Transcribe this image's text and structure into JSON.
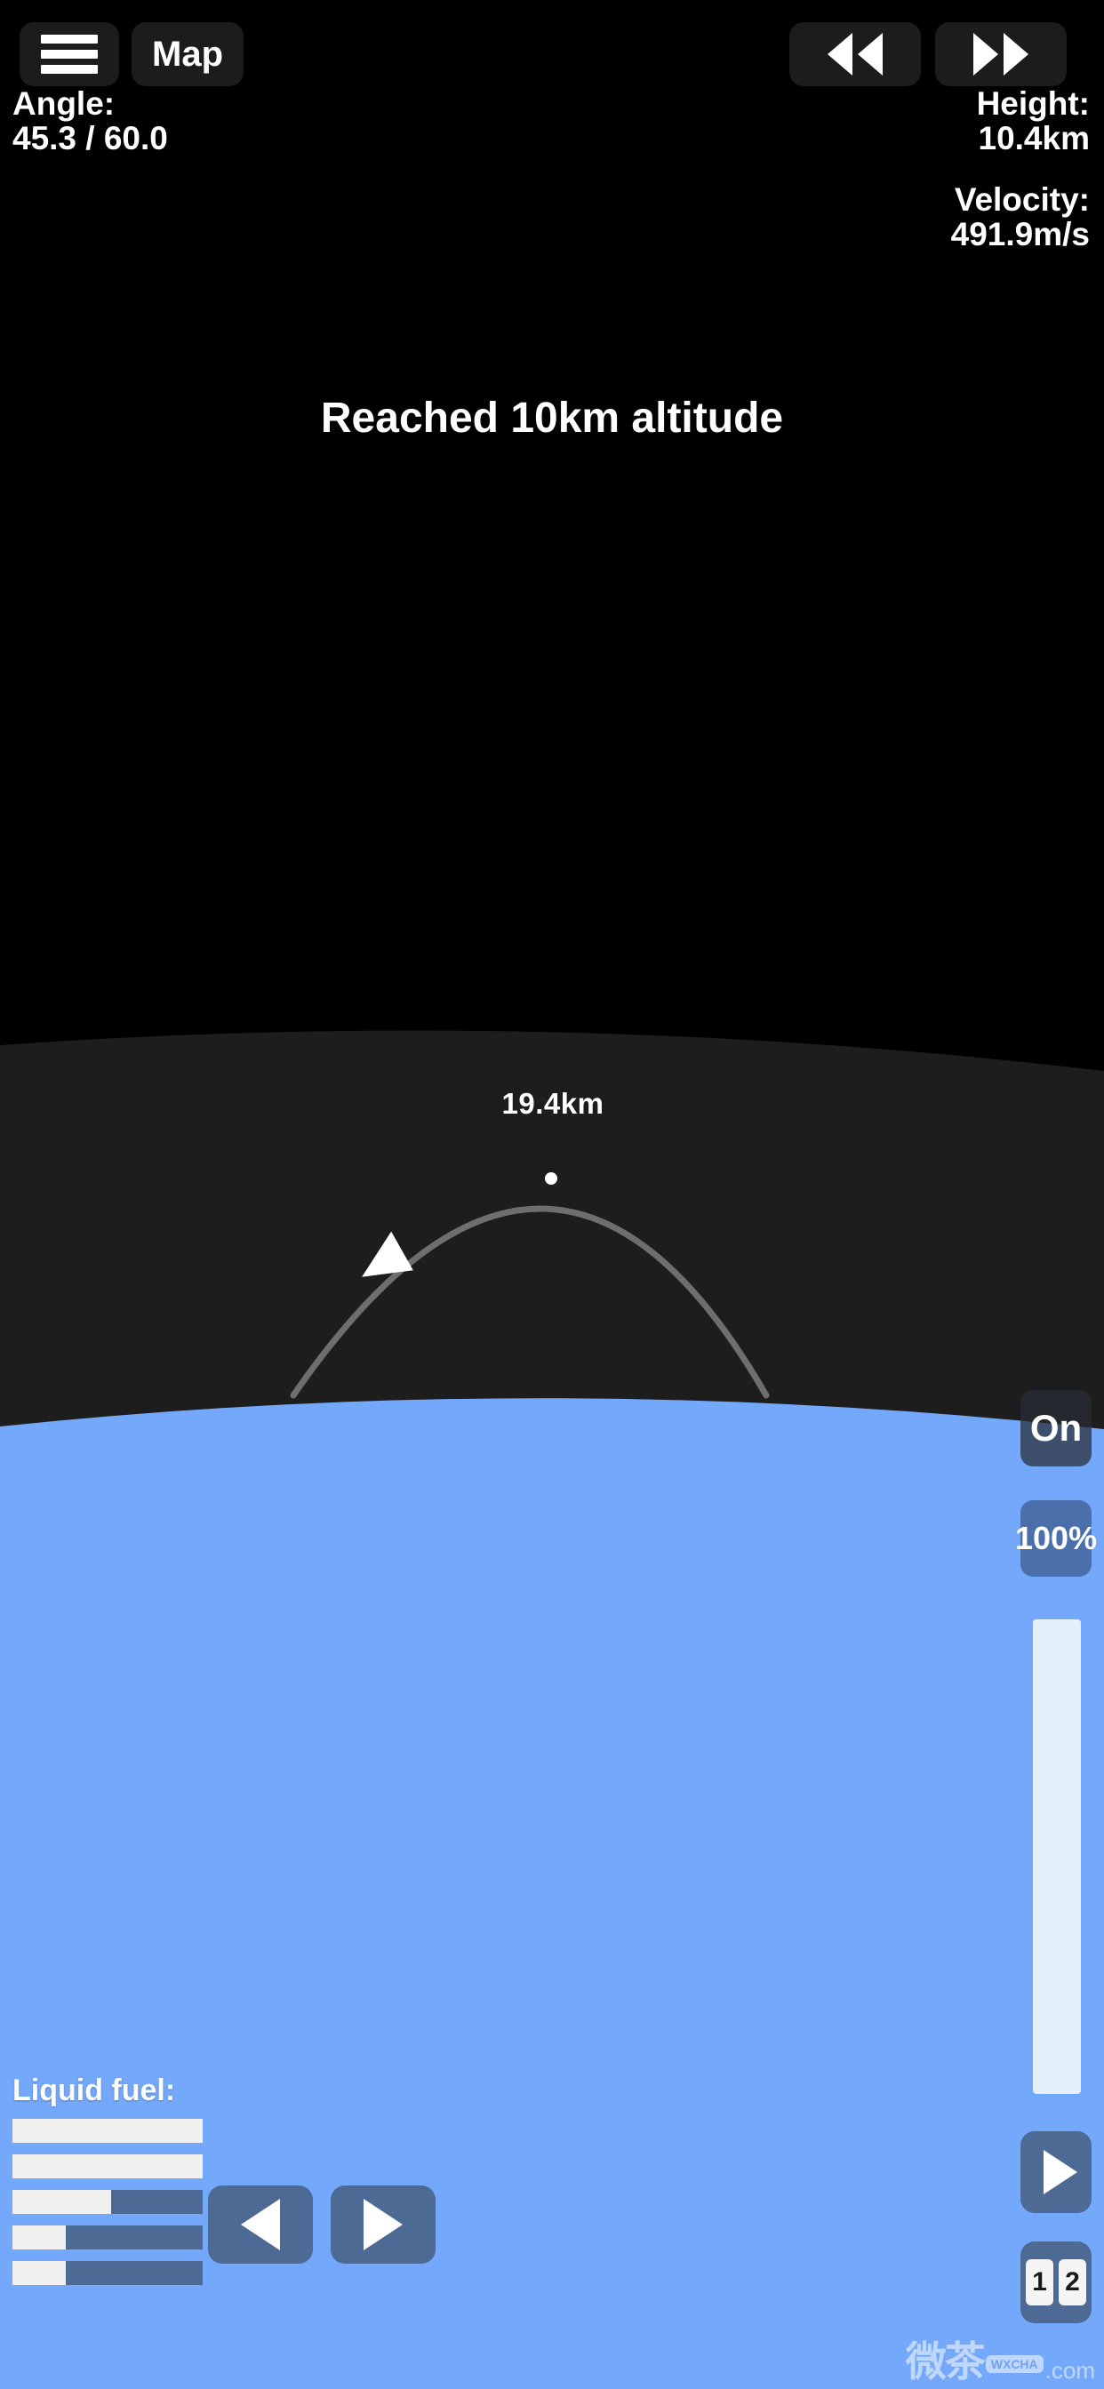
{
  "app": {
    "title": "Spaceflight Simulator"
  },
  "topbar": {
    "menu_icon": "hamburger-menu-icon",
    "map_label": "Map",
    "rewind_icon": "rewind-icon",
    "forward_icon": "fast-forward-icon"
  },
  "hud": {
    "angle_label": "Angle:",
    "angle_value": "45.3 / 60.0",
    "height_label": "Height:",
    "height_value": "10.4km",
    "velocity_label": "Velocity:",
    "velocity_value": "491.9m/s"
  },
  "message": {
    "text": "Reached 10km altitude"
  },
  "trajectory": {
    "apoapsis_label": "19.4km",
    "apoapsis_marker": "apoapsis-dot",
    "craft_marker": "craft-arrow-icon",
    "path_color": "#6e6e6e"
  },
  "controls": {
    "engine_label": "On",
    "throttle_label": "100%",
    "throttle_percent": 100,
    "rcs_icon": "play-triangle-icon",
    "rotate_left_icon": "triangle-left-icon",
    "rotate_right_icon": "triangle-right-icon"
  },
  "stages": {
    "items": [
      "1",
      "2"
    ]
  },
  "fuel": {
    "title": "Liquid fuel:",
    "bars": [
      {
        "name": "fuel-bar-1",
        "percent": 100
      },
      {
        "name": "fuel-bar-2",
        "percent": 100
      },
      {
        "name": "fuel-bar-3",
        "percent": 52
      },
      {
        "name": "fuel-bar-4",
        "percent": 28
      },
      {
        "name": "fuel-bar-5",
        "percent": 28
      }
    ]
  },
  "watermark": {
    "cn": "微茶",
    "badge": "WXCHA",
    "domain": ".com"
  },
  "colors": {
    "space": "#000000",
    "atmosphere": "#1d1d1d",
    "ground": "#74a8fa",
    "button_dark": "#1c1c1c",
    "button_blue": "#4d6a94",
    "fuel_fill": "#f0f0f0",
    "throttle_fill": "#e4f0fc",
    "text": "#ffffff"
  }
}
